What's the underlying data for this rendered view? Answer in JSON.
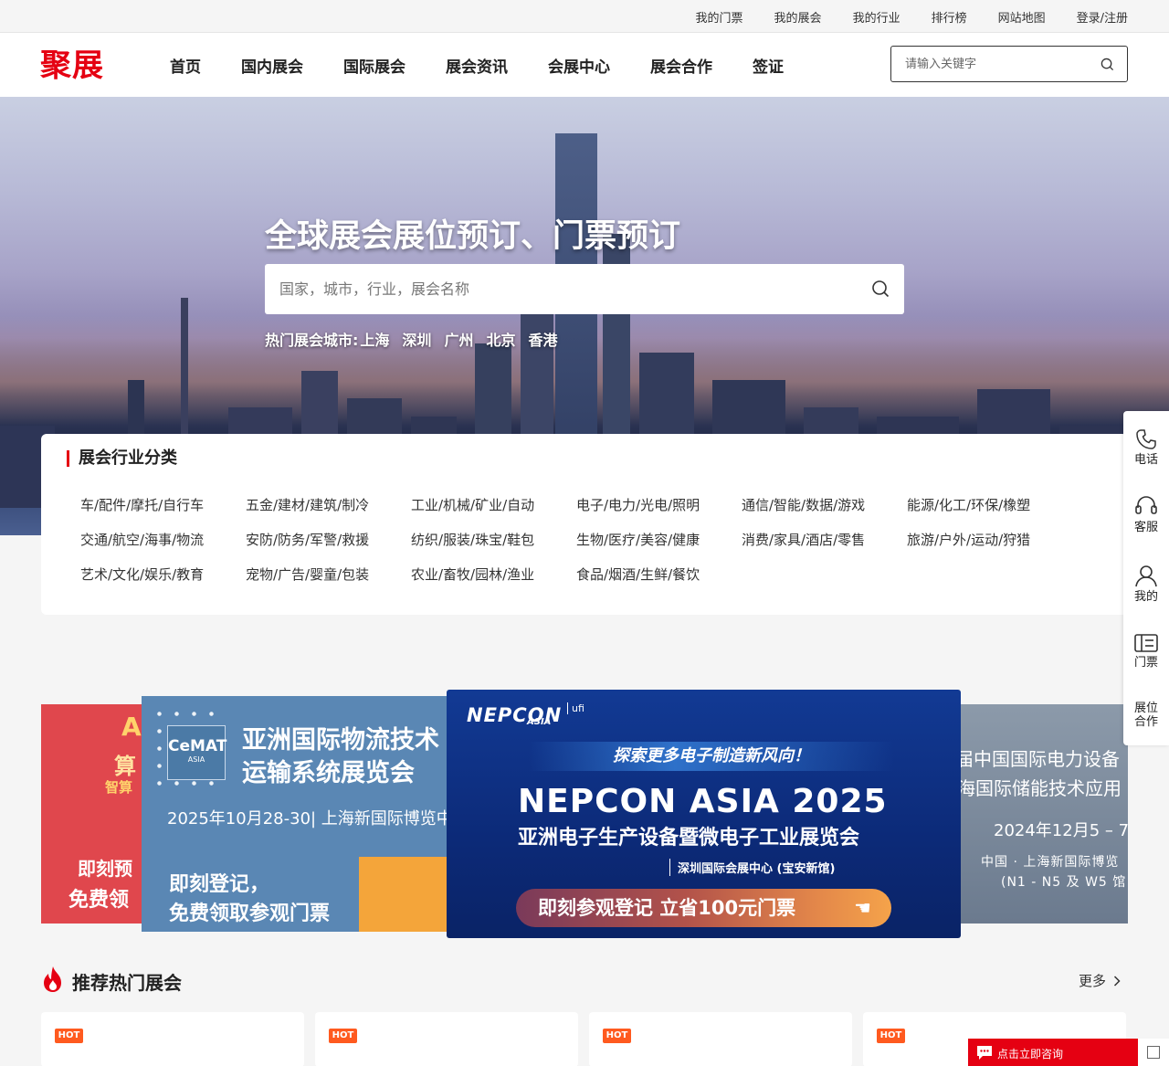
{
  "topbar": {
    "links": [
      "我的门票",
      "我的展会",
      "我的行业",
      "排行榜",
      "网站地图",
      "登录/注册"
    ]
  },
  "header": {
    "logo_text": "聚展",
    "nav": [
      "首页",
      "国内展会",
      "国际展会",
      "展会资讯",
      "会展中心",
      "展会合作",
      "签证"
    ],
    "search_placeholder": "请输入关键字"
  },
  "hero": {
    "title": "全球展会展位预订、门票预订",
    "search_placeholder": "国家，城市，行业，展会名称",
    "hot_label": "热门展会城市:",
    "hot_cities": [
      "上海",
      "深圳",
      "广州",
      "北京",
      "香港"
    ]
  },
  "categories": {
    "title": "展会行业分类",
    "items": [
      "车/配件/摩托/自行车",
      "五金/建材/建筑/制冷",
      "工业/机械/矿业/自动",
      "电子/电力/光电/照明",
      "通信/智能/数据/游戏",
      "能源/化工/环保/橡塑",
      "交通/航空/海事/物流",
      "安防/防务/军警/救援",
      "纺织/服装/珠宝/鞋包",
      "生物/医疗/美容/健康",
      "消费/家具/酒店/零售",
      "旅游/户外/运动/狩猎",
      "艺术/文化/娱乐/教育",
      "宠物/广告/婴童/包装",
      "农业/畜牧/园林/渔业",
      "食品/烟酒/生鲜/餐饮"
    ]
  },
  "banners": {
    "left": {
      "t1": "A",
      "t2": "算",
      "t3": "智算",
      "t4": "即刻预",
      "t5": "免费领"
    },
    "cemat": {
      "logo_main": "CeMAT",
      "logo_sub": "ASIA",
      "title1": "亚洲国际物流技术",
      "title2": "运输系统展览会",
      "date": "2025年10月28-30| 上海新国际博览中",
      "cta1": "即刻登记，",
      "cta2": "免费领取参观门票"
    },
    "nepcon": {
      "logo": "NEPCON",
      "logo_sub": "ASIA",
      "ufi": "ufi",
      "strip": "探索更多电子制造新风向！",
      "title": "NEPCON ASIA 2025",
      "subtitle": "亚洲电子生产设备暨微电子工业展览会",
      "venue": "深圳国际会展中心 (宝安新馆)",
      "cta": "即刻参观登记 立省100元门票"
    },
    "right": {
      "r1": "届中国国际电力设备",
      "r2": "海国际储能技术应用",
      "r3": "2024年12月5 – 7",
      "r4": "中国 · 上海新国际博览",
      "r5": "(N1 - N5 及 W5 馆"
    }
  },
  "recommend": {
    "title": "推荐热门展会",
    "more": "更多",
    "badge": "HOT",
    "card_count_visible": 4
  },
  "sidebar": {
    "items": [
      "电话",
      "客服",
      "我的",
      "门票",
      "展位合作"
    ]
  },
  "chat": {
    "label": "点击立即咨询"
  },
  "colors": {
    "brand": "#e50012",
    "hot_badge": "#ff5a1f",
    "nepcon_bg": "#0c2a78",
    "cemat_bg": "#5a87b4"
  }
}
